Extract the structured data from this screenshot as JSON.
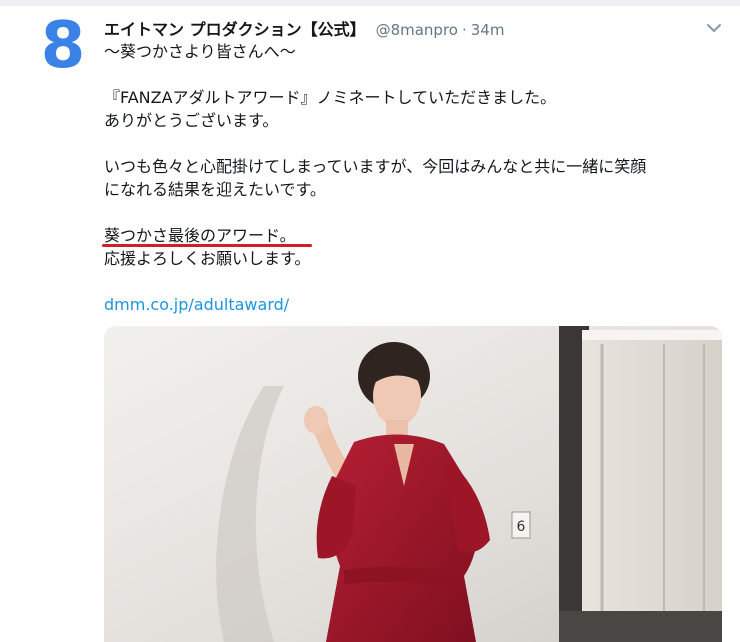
{
  "tweet": {
    "avatar_text": "8",
    "display_name": "エイトマン プロダクション【公式】",
    "handle": "@8manpro",
    "separator": "·",
    "time": "34m",
    "lines": [
      "〜葵つかさより皆さんへ〜",
      "",
      "『FANZAアダルトアワード』ノミネートしていただきました。",
      "ありがとうございます。",
      "",
      "いつも色々と心配掛けてしまっていますが、今回はみんなと共に一緒に笑顔",
      "になれる結果を迎えたいです。",
      "",
      "葵つかさ最後のアワード。",
      "応援よろしくお願いします。",
      ""
    ],
    "link": "dmm.co.jp/adultaward/",
    "photo_wall_number": "6"
  },
  "colors": {
    "accent": "#3b82e6",
    "link": "#1b95e0",
    "underline": "#d11f2a",
    "dress": "#a8182c"
  }
}
